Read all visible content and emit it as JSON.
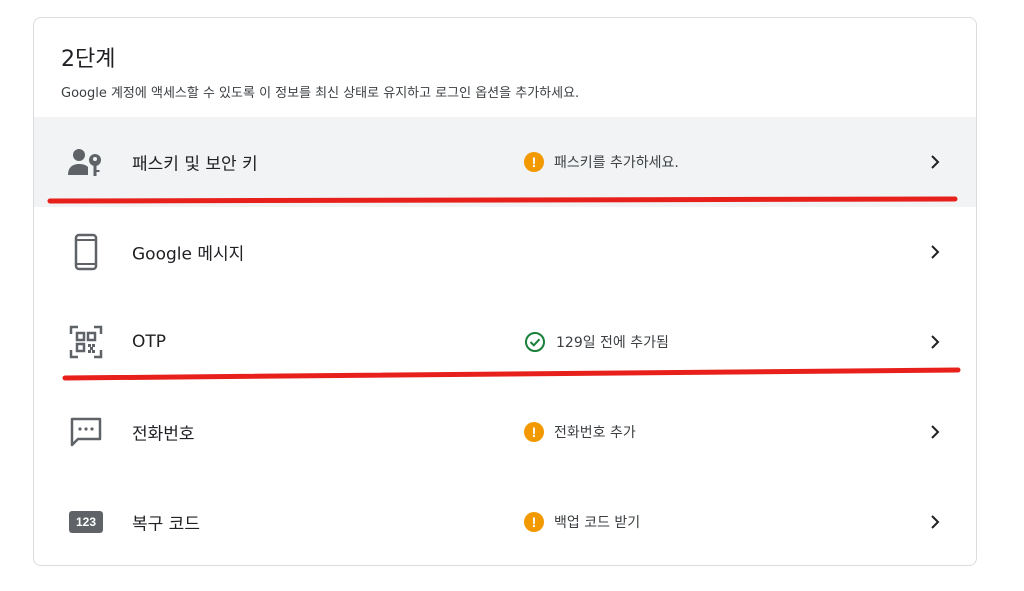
{
  "header": {
    "title": "2단계",
    "subtitle": "Google 계정에 액세스할 수 있도록 이 정보를 최신 상태로 유지하고 로그인 옵션을 추가하세요."
  },
  "rows": [
    {
      "label": "패스키 및 보안 키",
      "status": "패스키를 추가하세요.",
      "status_type": "warning",
      "icon": "passkey-icon",
      "highlighted": true
    },
    {
      "label": "Google 메시지",
      "status": "",
      "status_type": "none",
      "icon": "phone-icon",
      "highlighted": false
    },
    {
      "label": "OTP",
      "status": "129일 전에 추가됨",
      "status_type": "ok",
      "icon": "qr-code-icon",
      "highlighted": false
    },
    {
      "label": "전화번호",
      "status": "전화번호 추가",
      "status_type": "warning",
      "icon": "message-icon",
      "highlighted": false
    },
    {
      "label": "복구 코드",
      "status": "백업 코드 받기",
      "status_type": "warning",
      "icon": "number-badge-icon",
      "icon_text": "123",
      "highlighted": false
    }
  ],
  "colors": {
    "warning": "#f29900",
    "ok": "#188038",
    "annotation_line": "#e8201c",
    "highlight_bg": "#f1f3f4"
  }
}
